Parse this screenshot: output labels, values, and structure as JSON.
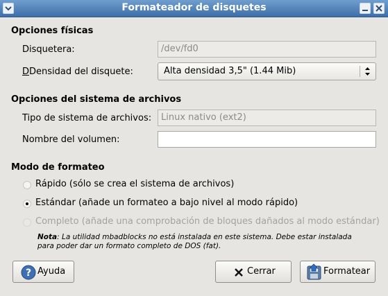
{
  "window": {
    "title": "Formateador de disquetes"
  },
  "physical": {
    "heading": "Opciones físicas",
    "drive_label": "Disquetera:",
    "drive_value": "/dev/fd0",
    "density_label": "Densidad del disquete:",
    "density_value": "Alta densidad 3,5\" (1.44 Mib)"
  },
  "filesystem": {
    "heading": "Opciones del sistema de archivos",
    "type_label": "Tipo de sistema de archivos:",
    "type_value": "Linux nativo (ext2)",
    "volume_label": "Nombre del volumen:",
    "volume_value": ""
  },
  "mode": {
    "heading": "Modo de formateo",
    "options": [
      {
        "label": "Rápido (sólo se crea el sistema de archivos)",
        "checked": false,
        "enabled": true
      },
      {
        "label": "Estándar (añade un formateo a bajo nivel al modo rápido)",
        "checked": true,
        "enabled": true
      },
      {
        "label": "Completo (añade una comprobación de bloques dañados al modo estándar)",
        "checked": false,
        "enabled": false
      }
    ],
    "note_title": "Nota",
    "note_text": ": La utilidad mbadblocks no está instalada en este sistema. Debe estar instalada para poder dar un formato completo de DOS (fat)."
  },
  "buttons": {
    "help": "Ayuda",
    "close": "Cerrar",
    "format": "Formatear"
  },
  "icons": {
    "help": "help-icon",
    "close": "close-x-icon",
    "format": "format-disk-icon"
  },
  "colors": {
    "titlebar": "#4a79b0",
    "background": "#e6e5e1"
  }
}
